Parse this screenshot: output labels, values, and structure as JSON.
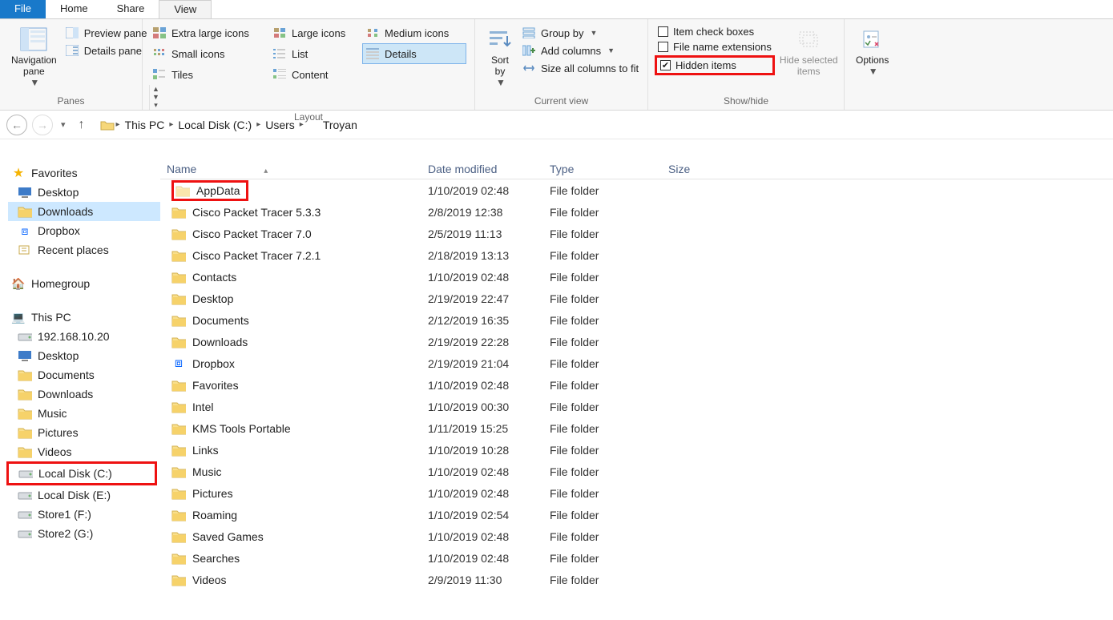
{
  "tabs": {
    "file": "File",
    "home": "Home",
    "share": "Share",
    "view": "View"
  },
  "ribbon": {
    "panes": {
      "nav": "Navigation\npane",
      "preview": "Preview pane",
      "details": "Details pane",
      "label": "Panes"
    },
    "layout": {
      "xl": "Extra large icons",
      "l": "Large icons",
      "m": "Medium icons",
      "s": "Small icons",
      "list": "List",
      "det": "Details",
      "tiles": "Tiles",
      "content": "Content",
      "label": "Layout"
    },
    "current": {
      "sort": "Sort\nby",
      "group": "Group by",
      "addcol": "Add columns",
      "sizeall": "Size all columns to fit",
      "label": "Current view"
    },
    "showhide": {
      "itemchk": "Item check boxes",
      "ext": "File name extensions",
      "hidden": "Hidden items",
      "hidesel": "Hide selected\nitems",
      "label": "Show/hide"
    },
    "options": "Options"
  },
  "breadcrumb": [
    "This PC",
    "Local Disk (C:)",
    "Users",
    "Troyan"
  ],
  "sidebar": {
    "favorites": "Favorites",
    "fav_items": [
      "Desktop",
      "Downloads",
      "Dropbox",
      "Recent places"
    ],
    "homegroup": "Homegroup",
    "thispc": "This PC",
    "pc_items": [
      "192.168.10.20",
      "Desktop",
      "Documents",
      "Downloads",
      "Music",
      "Pictures",
      "Videos",
      "Local Disk (C:)",
      "Local Disk (E:)",
      "Store1 (F:)",
      "Store2 (G:)"
    ]
  },
  "columns": {
    "name": "Name",
    "date": "Date modified",
    "type": "Type",
    "size": "Size"
  },
  "files": [
    {
      "n": "AppData",
      "d": "1/10/2019 02:48",
      "t": "File folder",
      "hl": true,
      "dim": true
    },
    {
      "n": "Cisco Packet Tracer 5.3.3",
      "d": "2/8/2019 12:38",
      "t": "File folder"
    },
    {
      "n": "Cisco Packet Tracer 7.0",
      "d": "2/5/2019 11:13",
      "t": "File folder"
    },
    {
      "n": "Cisco Packet Tracer 7.2.1",
      "d": "2/18/2019 13:13",
      "t": "File folder"
    },
    {
      "n": "Contacts",
      "d": "1/10/2019 02:48",
      "t": "File folder",
      "sp": "contacts"
    },
    {
      "n": "Desktop",
      "d": "2/19/2019 22:47",
      "t": "File folder",
      "sp": "desktop"
    },
    {
      "n": "Documents",
      "d": "2/12/2019 16:35",
      "t": "File folder",
      "sp": "documents"
    },
    {
      "n": "Downloads",
      "d": "2/19/2019 22:28",
      "t": "File folder",
      "sp": "downloads"
    },
    {
      "n": "Dropbox",
      "d": "2/19/2019 21:04",
      "t": "File folder",
      "sp": "dropbox"
    },
    {
      "n": "Favorites",
      "d": "1/10/2019 02:48",
      "t": "File folder",
      "sp": "favorites"
    },
    {
      "n": "Intel",
      "d": "1/10/2019 00:30",
      "t": "File folder"
    },
    {
      "n": "KMS Tools Portable",
      "d": "1/11/2019 15:25",
      "t": "File folder"
    },
    {
      "n": "Links",
      "d": "1/10/2019 10:28",
      "t": "File folder",
      "sp": "links"
    },
    {
      "n": "Music",
      "d": "1/10/2019 02:48",
      "t": "File folder",
      "sp": "music"
    },
    {
      "n": "Pictures",
      "d": "1/10/2019 02:48",
      "t": "File folder",
      "sp": "pictures"
    },
    {
      "n": "Roaming",
      "d": "1/10/2019 02:54",
      "t": "File folder"
    },
    {
      "n": "Saved Games",
      "d": "1/10/2019 02:48",
      "t": "File folder",
      "sp": "games"
    },
    {
      "n": "Searches",
      "d": "1/10/2019 02:48",
      "t": "File folder",
      "sp": "search"
    },
    {
      "n": "Videos",
      "d": "2/9/2019 11:30",
      "t": "File folder",
      "sp": "videos"
    }
  ]
}
